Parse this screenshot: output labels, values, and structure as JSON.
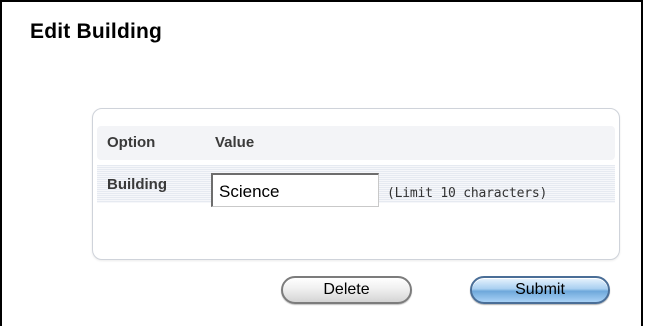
{
  "page": {
    "title": "Edit Building"
  },
  "table": {
    "headers": [
      "Option",
      "Value"
    ],
    "rows": [
      {
        "label": "Building",
        "input_value": "Science",
        "hint": "(Limit 10 characters)"
      }
    ]
  },
  "actions": {
    "delete_label": "Delete",
    "submit_label": "Submit"
  },
  "colors": {
    "submit_accent": "#7fb3e3",
    "panel_border": "#cfd3da"
  }
}
